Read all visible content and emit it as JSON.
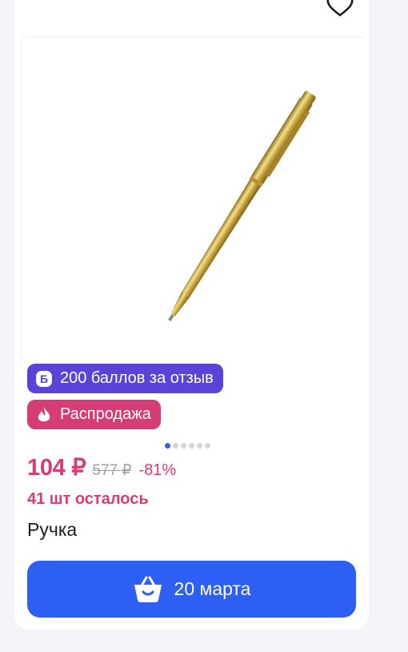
{
  "product": {
    "title": "Ручка",
    "price_current": "104 ₽",
    "price_old": "577 ₽",
    "discount": "-81%",
    "stock_text": "41 шт осталось"
  },
  "badges": {
    "bonus_label": "200 баллов за отзыв",
    "bonus_icon_letter": "Б",
    "sale_label": "Распродажа"
  },
  "gallery": {
    "total_images": 6,
    "active_index": 0
  },
  "cart_button": {
    "label": "20 марта"
  },
  "colors": {
    "accent_blue": "#2d5ff2",
    "sale_pink": "#d63c76",
    "bonus_purple": "#5a43d6",
    "old_price_gray": "#9fa1a8"
  },
  "icons": {
    "favorite": "heart-icon",
    "bonus": "points-b-icon",
    "sale": "flame-icon",
    "cart": "basket-icon"
  }
}
